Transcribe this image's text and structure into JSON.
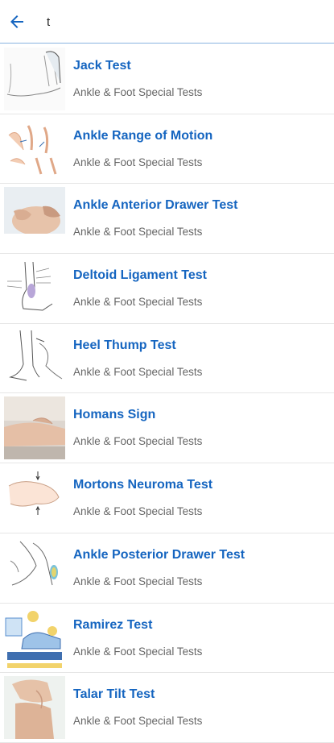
{
  "search": {
    "query": "t"
  },
  "results": [
    {
      "title": "Jack Test",
      "category": "Ankle & Foot Special Tests",
      "thumbnail": "foot-sketch"
    },
    {
      "title": "Ankle Range of Motion",
      "category": "Ankle & Foot Special Tests",
      "thumbnail": "range-of-motion-diagram"
    },
    {
      "title": "Ankle Anterior Drawer Test",
      "category": "Ankle & Foot Special Tests",
      "thumbnail": "hands-on-foot-photo"
    },
    {
      "title": "Deltoid Ligament Test",
      "category": "Ankle & Foot Special Tests",
      "thumbnail": "ligament-diagram"
    },
    {
      "title": "Heel Thump Test",
      "category": "Ankle & Foot Special Tests",
      "thumbnail": "leg-sketch"
    },
    {
      "title": "Homans Sign",
      "category": "Ankle & Foot Special Tests",
      "thumbnail": "calf-photo"
    },
    {
      "title": "Mortons Neuroma Test",
      "category": "Ankle & Foot Special Tests",
      "thumbnail": "hand-squeezing-foot-sketch"
    },
    {
      "title": "Ankle Posterior Drawer Test",
      "category": "Ankle & Foot Special Tests",
      "thumbnail": "ankle-sketch"
    },
    {
      "title": "Ramirez Test",
      "category": "Ankle & Foot Special Tests",
      "thumbnail": "exam-table-illustration"
    },
    {
      "title": "Talar Tilt Test",
      "category": "Ankle & Foot Special Tests",
      "thumbnail": "foot-photo"
    }
  ],
  "colors": {
    "accent": "#1565c0",
    "subtitle": "#666666",
    "divider": "#e6e6e6",
    "search_border": "#8ab4e0"
  },
  "icons": {
    "back": "arrow-left-icon"
  }
}
